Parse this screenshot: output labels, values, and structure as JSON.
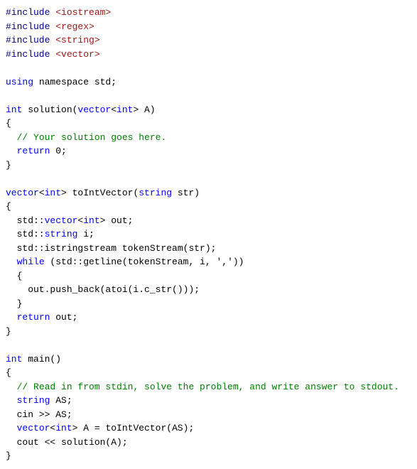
{
  "code": {
    "lines": [
      {
        "id": 1,
        "parts": [
          {
            "text": "#include ",
            "class": "kw-darkblue"
          },
          {
            "text": "<iostream>",
            "class": "inc-red"
          }
        ]
      },
      {
        "id": 2,
        "parts": [
          {
            "text": "#include ",
            "class": "kw-darkblue"
          },
          {
            "text": "<regex>",
            "class": "inc-red"
          }
        ]
      },
      {
        "id": 3,
        "parts": [
          {
            "text": "#include ",
            "class": "kw-darkblue"
          },
          {
            "text": "<string>",
            "class": "inc-red"
          }
        ]
      },
      {
        "id": 4,
        "parts": [
          {
            "text": "#include ",
            "class": "kw-darkblue"
          },
          {
            "text": "<vector>",
            "class": "inc-red"
          }
        ]
      },
      {
        "id": 5,
        "parts": [
          {
            "text": "",
            "class": "plain"
          }
        ]
      },
      {
        "id": 6,
        "parts": [
          {
            "text": "using",
            "class": "kw-blue"
          },
          {
            "text": " namespace std;",
            "class": "plain"
          }
        ]
      },
      {
        "id": 7,
        "parts": [
          {
            "text": "",
            "class": "plain"
          }
        ]
      },
      {
        "id": 8,
        "parts": [
          {
            "text": "int",
            "class": "kw-blue"
          },
          {
            "text": " solution(",
            "class": "plain"
          },
          {
            "text": "vector",
            "class": "kw-blue"
          },
          {
            "text": "<",
            "class": "plain"
          },
          {
            "text": "int",
            "class": "kw-blue"
          },
          {
            "text": "> A)",
            "class": "plain"
          }
        ]
      },
      {
        "id": 9,
        "parts": [
          {
            "text": "{",
            "class": "plain"
          }
        ]
      },
      {
        "id": 10,
        "parts": [
          {
            "text": "  ",
            "class": "plain"
          },
          {
            "text": "// Your solution goes here.",
            "class": "comment"
          }
        ]
      },
      {
        "id": 11,
        "parts": [
          {
            "text": "  ",
            "class": "plain"
          },
          {
            "text": "return",
            "class": "kw-blue"
          },
          {
            "text": " 0;",
            "class": "plain"
          }
        ]
      },
      {
        "id": 12,
        "parts": [
          {
            "text": "}",
            "class": "plain"
          }
        ]
      },
      {
        "id": 13,
        "parts": [
          {
            "text": "",
            "class": "plain"
          }
        ]
      },
      {
        "id": 14,
        "parts": [
          {
            "text": "vector",
            "class": "kw-blue"
          },
          {
            "text": "<",
            "class": "plain"
          },
          {
            "text": "int",
            "class": "kw-blue"
          },
          {
            "text": "> toIntVector(",
            "class": "plain"
          },
          {
            "text": "string",
            "class": "kw-blue"
          },
          {
            "text": " str)",
            "class": "plain"
          }
        ]
      },
      {
        "id": 15,
        "parts": [
          {
            "text": "{",
            "class": "plain"
          }
        ]
      },
      {
        "id": 16,
        "parts": [
          {
            "text": "  std::",
            "class": "plain"
          },
          {
            "text": "vector",
            "class": "kw-blue"
          },
          {
            "text": "<",
            "class": "plain"
          },
          {
            "text": "int",
            "class": "kw-blue"
          },
          {
            "text": "> out;",
            "class": "plain"
          }
        ]
      },
      {
        "id": 17,
        "parts": [
          {
            "text": "  std::",
            "class": "plain"
          },
          {
            "text": "string",
            "class": "kw-blue"
          },
          {
            "text": " i;",
            "class": "plain"
          }
        ]
      },
      {
        "id": 18,
        "parts": [
          {
            "text": "  std::istringstream tokenStream(str);",
            "class": "plain"
          }
        ]
      },
      {
        "id": 19,
        "parts": [
          {
            "text": "  ",
            "class": "plain"
          },
          {
            "text": "while",
            "class": "kw-blue"
          },
          {
            "text": " (std::getline(tokenStream, i, ','))",
            "class": "plain"
          }
        ]
      },
      {
        "id": 20,
        "parts": [
          {
            "text": "  {",
            "class": "plain"
          }
        ]
      },
      {
        "id": 21,
        "parts": [
          {
            "text": "    out.push_back(atoi(i.c_str()));",
            "class": "plain"
          }
        ]
      },
      {
        "id": 22,
        "parts": [
          {
            "text": "  }",
            "class": "plain"
          }
        ]
      },
      {
        "id": 23,
        "parts": [
          {
            "text": "  ",
            "class": "plain"
          },
          {
            "text": "return",
            "class": "kw-blue"
          },
          {
            "text": " out;",
            "class": "plain"
          }
        ]
      },
      {
        "id": 24,
        "parts": [
          {
            "text": "}",
            "class": "plain"
          }
        ]
      },
      {
        "id": 25,
        "parts": [
          {
            "text": "",
            "class": "plain"
          }
        ]
      },
      {
        "id": 26,
        "parts": [
          {
            "text": "int",
            "class": "kw-blue"
          },
          {
            "text": " main()",
            "class": "plain"
          }
        ]
      },
      {
        "id": 27,
        "parts": [
          {
            "text": "{",
            "class": "plain"
          }
        ]
      },
      {
        "id": 28,
        "parts": [
          {
            "text": "  ",
            "class": "plain"
          },
          {
            "text": "// Read in from stdin, solve the problem, and write answer to stdout.",
            "class": "comment"
          }
        ]
      },
      {
        "id": 29,
        "parts": [
          {
            "text": "  ",
            "class": "plain"
          },
          {
            "text": "string",
            "class": "kw-blue"
          },
          {
            "text": " AS;",
            "class": "plain"
          }
        ]
      },
      {
        "id": 30,
        "parts": [
          {
            "text": "  cin >> AS;",
            "class": "plain"
          }
        ]
      },
      {
        "id": 31,
        "parts": [
          {
            "text": "  ",
            "class": "plain"
          },
          {
            "text": "vector",
            "class": "kw-blue"
          },
          {
            "text": "<",
            "class": "plain"
          },
          {
            "text": "int",
            "class": "kw-blue"
          },
          {
            "text": "> A = toIntVector(AS);",
            "class": "plain"
          }
        ]
      },
      {
        "id": 32,
        "parts": [
          {
            "text": "  cout << solution(A);",
            "class": "plain"
          }
        ]
      },
      {
        "id": 33,
        "parts": [
          {
            "text": "}",
            "class": "plain"
          }
        ]
      }
    ]
  }
}
